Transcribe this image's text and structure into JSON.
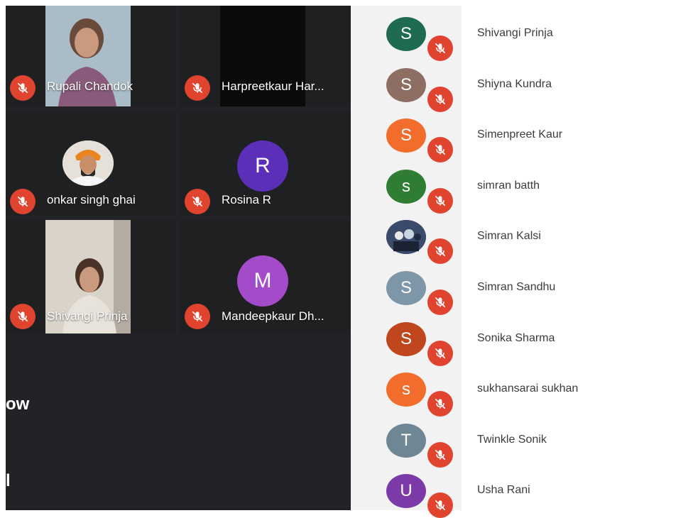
{
  "video_grid": {
    "tiles": [
      {
        "name": "Rupali Chandok",
        "muted": true,
        "type": "video"
      },
      {
        "name": "Harpreetkaur Har...",
        "muted": true,
        "type": "video-off"
      },
      {
        "name": "onkar singh ghai",
        "muted": true,
        "type": "photo"
      },
      {
        "name": "Rosina R",
        "muted": true,
        "type": "initial",
        "initial": "R",
        "color": "#5b2fb8"
      },
      {
        "name": "Shivangi Prinja",
        "muted": true,
        "type": "video"
      },
      {
        "name": "Mandeepkaur Dh...",
        "muted": true,
        "type": "initial",
        "initial": "M",
        "color": "#a34bc9"
      }
    ],
    "partial_text_1": "ow",
    "partial_text_2": "l"
  },
  "participants": [
    {
      "initial": "S",
      "name": "Shivangi Prinja",
      "color": "#1f6a53",
      "muted": true
    },
    {
      "initial": "S",
      "name": "Shiyna Kundra",
      "color": "#8d6e63",
      "muted": true
    },
    {
      "initial": "S",
      "name": "Simenpreet Kaur",
      "color": "#f26c2b",
      "muted": true
    },
    {
      "initial": "s",
      "name": "simran batth",
      "color": "#2e7d32",
      "muted": true
    },
    {
      "initial": "",
      "name": "Simran Kalsi",
      "color": "#3a4a6b",
      "muted": true,
      "photo": true
    },
    {
      "initial": "S",
      "name": "Simran Sandhu",
      "color": "#7d97a8",
      "muted": true
    },
    {
      "initial": "S",
      "name": "Sonika Sharma",
      "color": "#c0461d",
      "muted": true
    },
    {
      "initial": "s",
      "name": "sukhansarai sukhan",
      "color": "#f26c2b",
      "muted": true
    },
    {
      "initial": "T",
      "name": "Twinkle Sonik",
      "color": "#6f8795",
      "muted": true
    },
    {
      "initial": "U",
      "name": "Usha Rani",
      "color": "#7b3aa8",
      "muted": true
    }
  ]
}
